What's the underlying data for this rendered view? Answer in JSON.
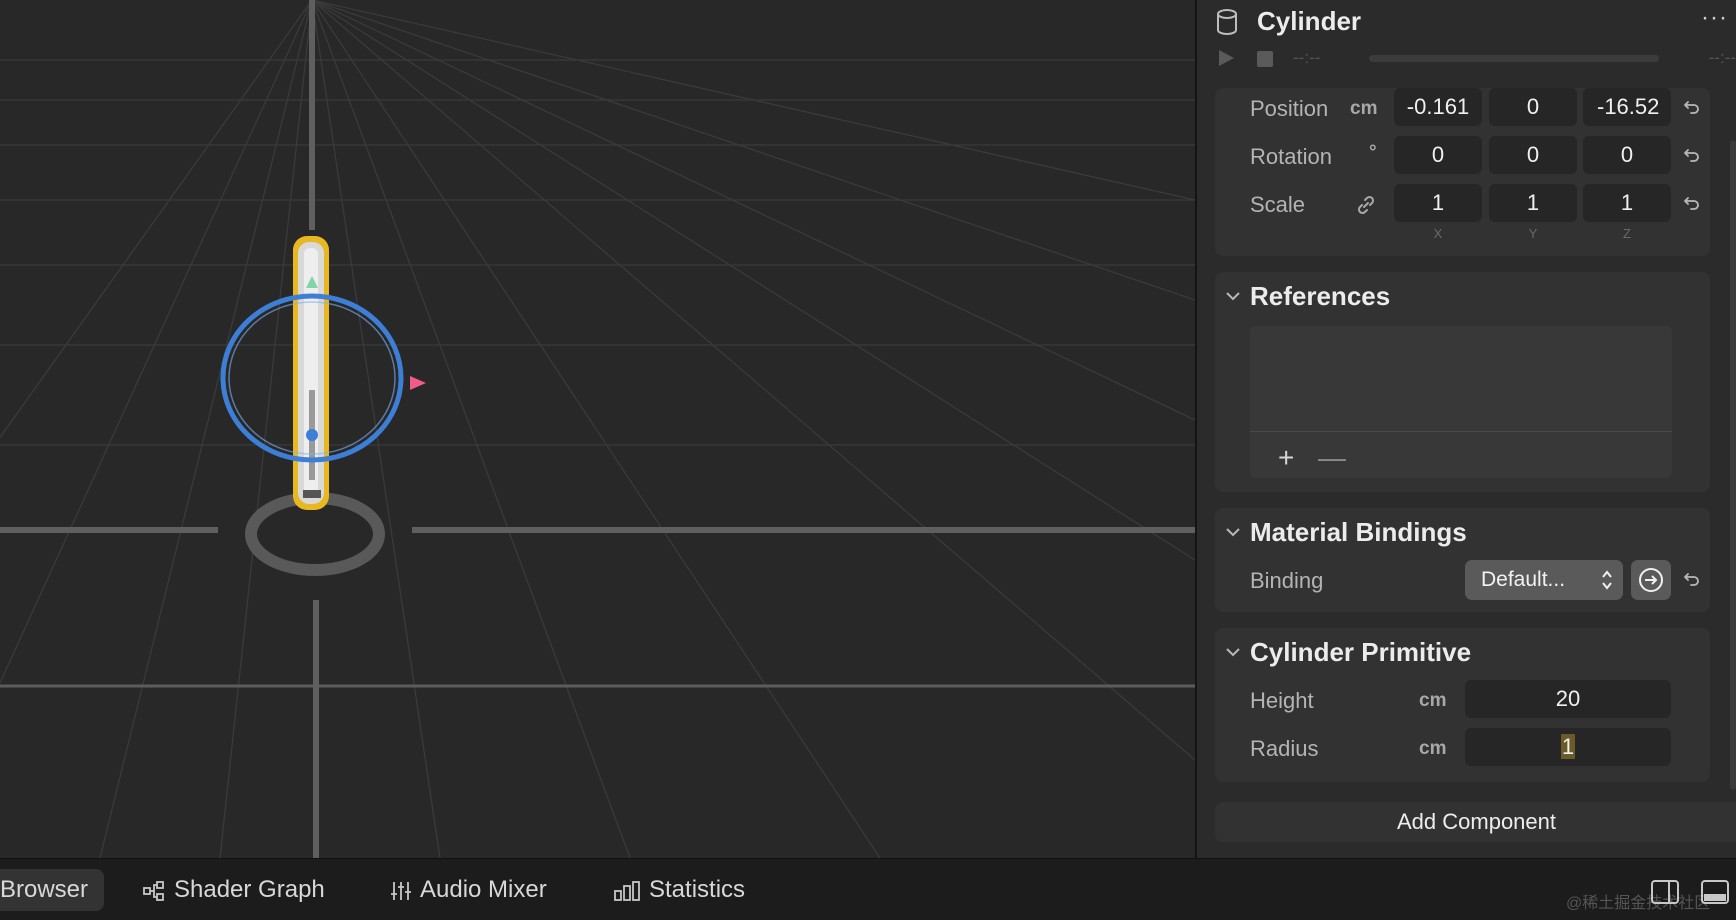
{
  "inspector": {
    "title": "Cylinder",
    "more": "···",
    "time_left": "--:--",
    "time_right": "--:--"
  },
  "transform": {
    "position_label": "Position",
    "position_unit": "cm",
    "position": [
      "-0.161",
      "0",
      "-16.52"
    ],
    "rotation_label": "Rotation",
    "rotation_unit": "°",
    "rotation": [
      "0",
      "0",
      "0"
    ],
    "scale_label": "Scale",
    "scale": [
      "1",
      "1",
      "1"
    ],
    "axes": [
      "X",
      "Y",
      "Z"
    ]
  },
  "references": {
    "title": "References",
    "add": "+",
    "remove": "—"
  },
  "material_bindings": {
    "title": "Material Bindings",
    "binding_label": "Binding",
    "binding_value": "Default..."
  },
  "cylinder_primitive": {
    "title": "Cylinder Primitive",
    "height_label": "Height",
    "height_unit": "cm",
    "height": "20",
    "radius_label": "Radius",
    "radius_unit": "cm",
    "radius": "1"
  },
  "add_component": "Add Component",
  "tabs": [
    "Browser",
    "Shader Graph",
    "Audio Mixer",
    "Statistics"
  ],
  "watermark": "@稀土掘金技术社区",
  "colors": {
    "selection_outline": "#e8b820",
    "rotate_gizmo": "#3d7fd6",
    "viewport_bg": "#282828",
    "panel_bg": "#2b2b2b"
  }
}
